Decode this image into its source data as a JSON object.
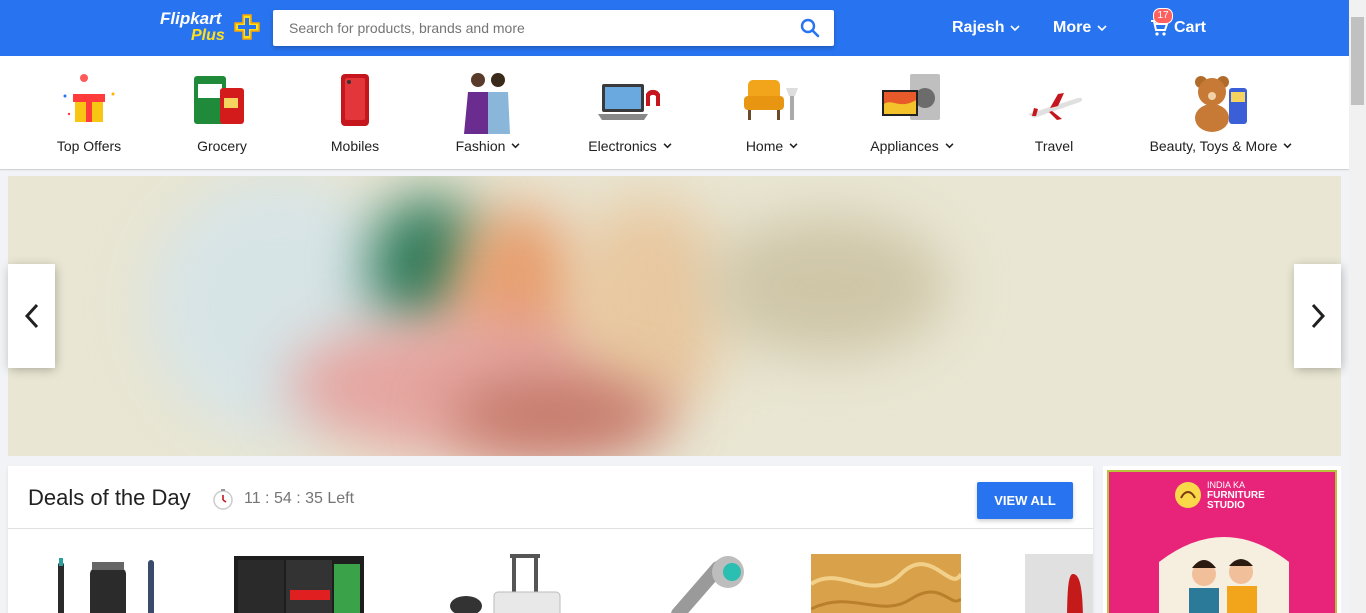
{
  "header": {
    "logo_text": "Flipkart",
    "logo_plus": "Plus",
    "search_placeholder": "Search for products, brands and more",
    "search_icon": "search-icon",
    "user_label": "Rajesh",
    "more_label": "More",
    "cart_label": "Cart",
    "cart_count": "17",
    "brand_color": "#2874f0",
    "plus_color": "#ffe11b"
  },
  "categories": [
    {
      "label": "Top Offers",
      "icon": "gift-icon",
      "dropdown": false
    },
    {
      "label": "Grocery",
      "icon": "grocery-icon",
      "dropdown": false
    },
    {
      "label": "Mobiles",
      "icon": "mobile-icon",
      "dropdown": false
    },
    {
      "label": "Fashion",
      "icon": "fashion-icon",
      "dropdown": true
    },
    {
      "label": "Electronics",
      "icon": "laptop-icon",
      "dropdown": true
    },
    {
      "label": "Home",
      "icon": "armchair-icon",
      "dropdown": true
    },
    {
      "label": "Appliances",
      "icon": "appliances-icon",
      "dropdown": true
    },
    {
      "label": "Travel",
      "icon": "airplane-icon",
      "dropdown": false
    },
    {
      "label": "Beauty, Toys & More",
      "icon": "teddy-bear-icon",
      "dropdown": true
    }
  ],
  "banner": {
    "prev_icon": "chevron-left-icon",
    "next_icon": "chevron-right-icon"
  },
  "deals": {
    "title": "Deals of the Day",
    "timer": "11 : 54 : 35 Left",
    "timer_icon": "clock-icon",
    "view_all_label": "VIEW ALL",
    "products": [
      {
        "name": "trimmer-product"
      },
      {
        "name": "garnier-men-product"
      },
      {
        "name": "luggage-product"
      },
      {
        "name": "health-faucet-product"
      },
      {
        "name": "gold-fabric-product"
      },
      {
        "name": "fashion-product"
      }
    ]
  },
  "ad": {
    "line1": "INDIA KA",
    "line2": "FURNITURE",
    "line3": "STUDIO"
  }
}
